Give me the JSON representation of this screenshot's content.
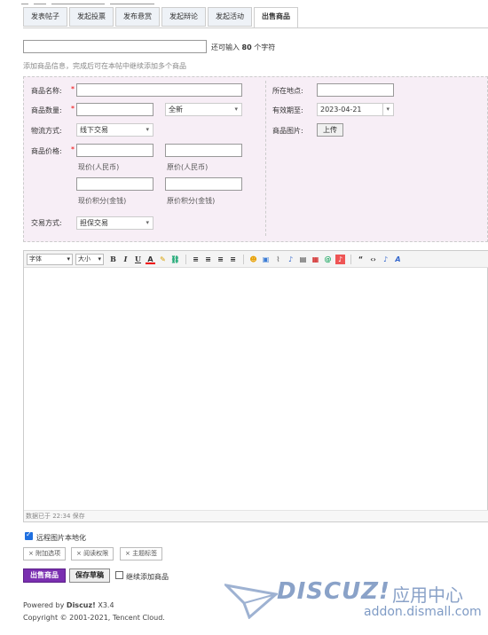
{
  "tabs": [
    "发表帖子",
    "发起投票",
    "发布悬赏",
    "发起辩论",
    "发起活动",
    "出售商品"
  ],
  "title_hint": {
    "prefix": "还可输入",
    "count": "80",
    "suffix": "个字符"
  },
  "trade_hint": "添加商品信息，完成后可在本帖中继续添加多个商品",
  "form": {
    "name_label": "商品名称:",
    "qty_label": "商品数量:",
    "condition_value": "全新",
    "logistics_label": "物流方式:",
    "logistics_value": "线下交易",
    "price_label": "商品价格:",
    "price_now": "现价(人民币)",
    "price_orig": "原价(人民币)",
    "credit_now": "现价积分(金钱)",
    "credit_orig": "原价积分(金钱)",
    "trade_label": "交易方式:",
    "trade_value": "担保交易",
    "location_label": "所在地点:",
    "expire_label": "有效期至:",
    "expire_value": "2023-04-21",
    "image_label": "商品图片:",
    "upload_button": "上传"
  },
  "editor": {
    "font_select": "字体",
    "size_select": "大小",
    "status": "数据已于 22:34 保存"
  },
  "options": {
    "remote_image": "远程图片本地化",
    "attach_options": "附加选项",
    "read_perm": "阅读权限",
    "topic_tags": "主题标签"
  },
  "actions": {
    "submit": "出售商品",
    "draft": "保存草稿",
    "continue_add": "继续添加商品"
  },
  "footer": {
    "powered_prefix": "Powered by",
    "powered_brand": "Discuz!",
    "version": "X3.4",
    "copyright": "Copyright © 2001-2021, Tencent Cloud."
  },
  "watermark": {
    "brand": "DISCUZ!",
    "cn": "应用中心",
    "url": "addon.dismall.com"
  },
  "colors": {
    "accent": "#7a2fb0",
    "trade_bg": "#f7eef6",
    "required": "#e00000"
  }
}
